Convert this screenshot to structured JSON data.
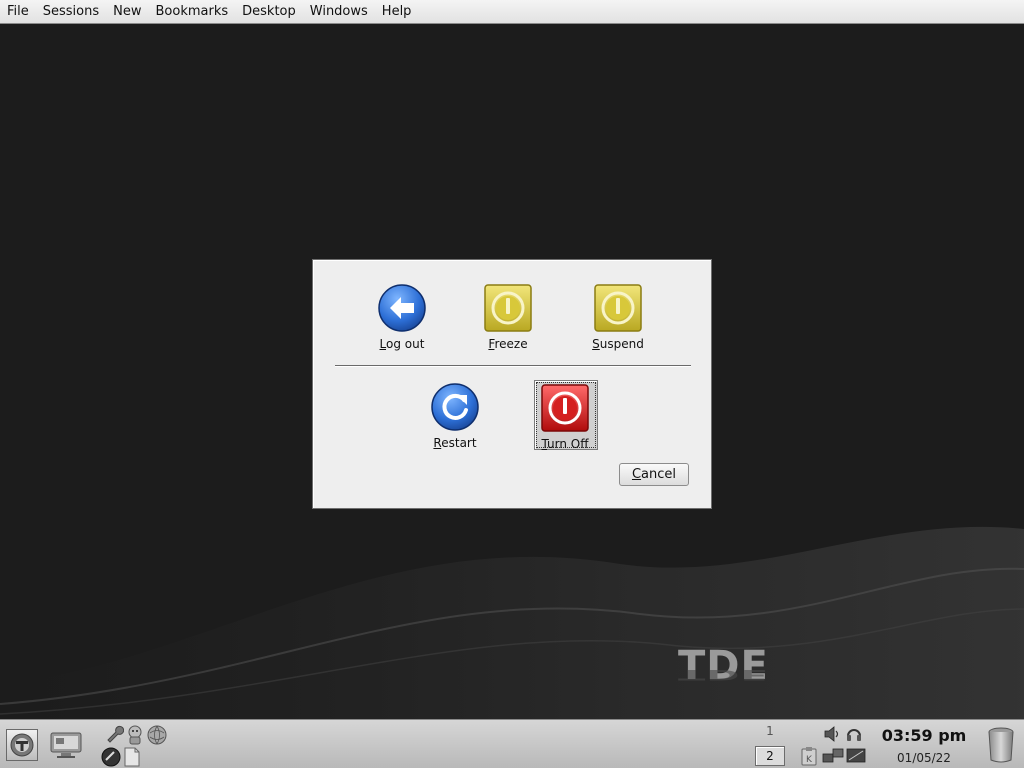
{
  "menubar": {
    "items": [
      "File",
      "Sessions",
      "New",
      "Bookmarks",
      "Desktop",
      "Windows",
      "Help"
    ]
  },
  "desktop": {
    "logo_text": "TDE"
  },
  "logout_dialog": {
    "options": {
      "logout": {
        "mnemonic": "L",
        "rest": "og out",
        "icon": "logout-arrow-icon"
      },
      "freeze": {
        "mnemonic": "F",
        "rest": "reeze",
        "icon": "power-yellow-icon"
      },
      "suspend": {
        "mnemonic": "S",
        "rest": "uspend",
        "icon": "power-yellow-icon"
      },
      "restart": {
        "mnemonic": "R",
        "rest": "estart",
        "icon": "restart-icon"
      },
      "turnoff": {
        "mnemonic": "T",
        "rest": "urn Off",
        "icon": "power-red-icon"
      }
    },
    "cancel": {
      "mnemonic": "C",
      "rest": "ancel"
    }
  },
  "taskbar": {
    "pager": {
      "desktop1": "1",
      "desktop2": "2"
    },
    "clock": {
      "time": "03:59 pm",
      "date": "01/05/22"
    }
  },
  "colors": {
    "desktop_bg": "#1c1c1c",
    "dialog_bg": "#eeeeee",
    "blue_button": "#2d6fd6",
    "yellow_button": "#d8c83a",
    "red_button": "#d42020"
  }
}
